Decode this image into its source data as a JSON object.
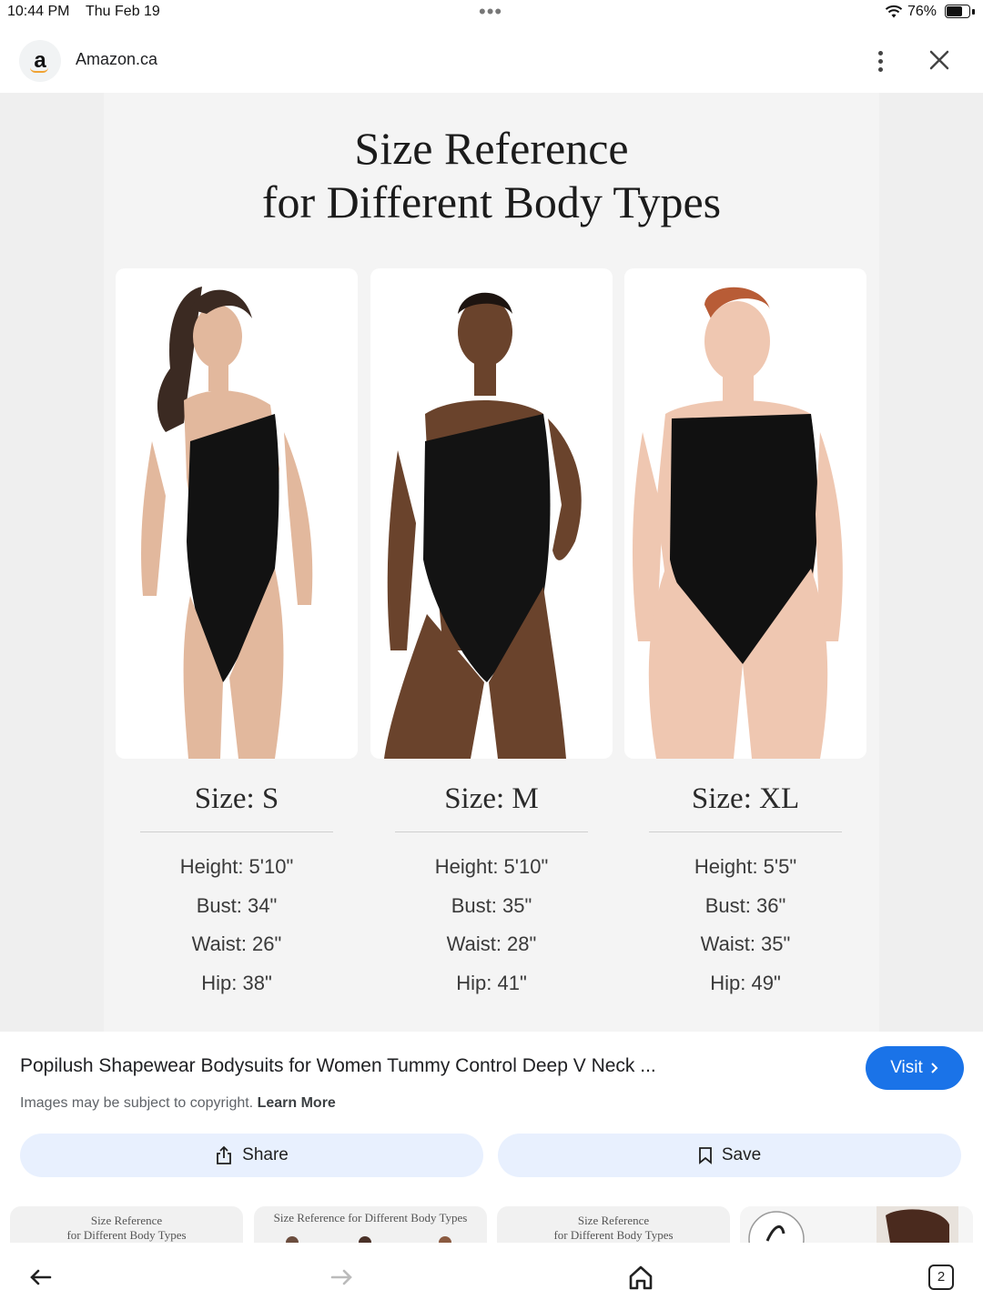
{
  "status_bar": {
    "time": "10:44 PM",
    "date": "Thu Feb 19",
    "battery_text": "76%",
    "battery_level": 0.76,
    "icons": [
      "wifi-icon",
      "battery-icon"
    ]
  },
  "header": {
    "site_logo_letter": "a",
    "site_name": "Amazon.ca",
    "icons": [
      "more-vert-icon",
      "close-icon"
    ]
  },
  "image": {
    "title_line1": "Size Reference",
    "title_line2": "for Different Body Types",
    "sizes": [
      {
        "label": "Size: S",
        "height": "Height: 5'10\"",
        "bust": "Bust: 34\"",
        "waist": "Waist: 26\"",
        "hip": "Hip: 38\""
      },
      {
        "label": "Size: M",
        "height": "Height: 5'10\"",
        "bust": "Bust: 35\"",
        "waist": "Waist: 28\"",
        "hip": "Hip: 41\""
      },
      {
        "label": "Size: XL",
        "height": "Height: 5'5\"",
        "bust": "Bust: 36\"",
        "waist": "Waist: 35\"",
        "hip": "Hip: 49\""
      }
    ]
  },
  "info": {
    "title": "Popilush Shapewear Bodysuits for Women Tummy Control Deep V Neck ...",
    "visit_label": "Visit",
    "copyright_text": "Images may be subject to copyright.",
    "learn_more": "Learn More",
    "share_label": "Share",
    "save_label": "Save",
    "accent_color": "#1a73e8"
  },
  "thumbnails": [
    {
      "line1": "Size Reference",
      "line2": "for Different Body Types"
    },
    {
      "line1": "Size Reference for Different Body Types",
      "line2": ""
    },
    {
      "line1": "Size Reference",
      "line2": "for Different Body Types"
    },
    {
      "line1": "",
      "line2": ""
    }
  ],
  "bottom_nav": {
    "tab_count": "2",
    "icons": [
      "back-arrow-icon",
      "forward-arrow-icon",
      "home-icon",
      "tabs-icon"
    ]
  }
}
